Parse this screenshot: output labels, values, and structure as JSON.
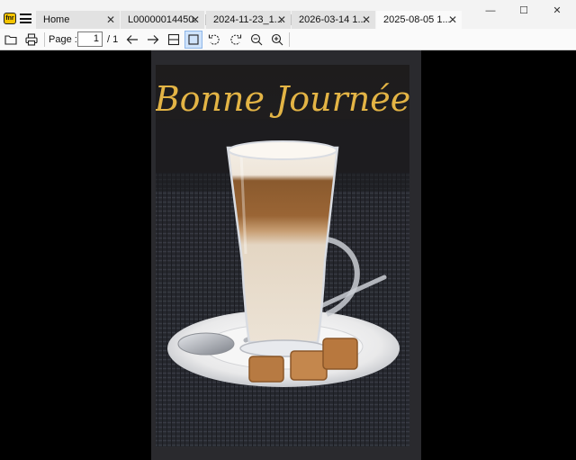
{
  "tabs": [
    {
      "label": "Home",
      "active": false
    },
    {
      "label": "L00000014450...",
      "active": false
    },
    {
      "label": "2024-11-23_1...",
      "active": false
    },
    {
      "label": "2026-03-14 1...",
      "active": false
    },
    {
      "label": "2025-08-05 1...",
      "active": true
    }
  ],
  "window": {
    "minimize": "—",
    "maximize": "☐",
    "close": "✕"
  },
  "toolbar": {
    "page_label": "Page :",
    "page_value": "1",
    "page_total": "/ 1"
  },
  "document": {
    "image_text": "Bonne Journée"
  },
  "icons": [
    "app-logo-icon",
    "menu-icon",
    "open-folder-icon",
    "print-icon",
    "arrow-left-icon",
    "arrow-right-icon",
    "fit-width-icon",
    "fit-page-icon",
    "rotate-left-icon",
    "rotate-right-icon",
    "zoom-out-icon",
    "zoom-in-icon",
    "close-icon"
  ],
  "colors": {
    "accent_selected": "#cfe3fb",
    "background": "#000000",
    "title_text": "#e3b445"
  }
}
